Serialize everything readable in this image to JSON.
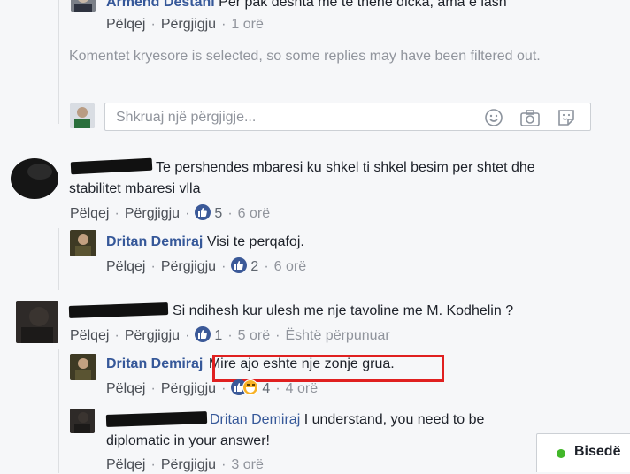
{
  "top_comment": {
    "author": "Armend Destani",
    "text": "Per pak deshta me te thene dicka, ama e lash",
    "actions": {
      "like": "Pëlqej",
      "reply": "Përgjigju",
      "time": "1 orë"
    }
  },
  "filter_notice": "Komentet kryesore is selected, so some replies may have been filtered out.",
  "reply_box": {
    "placeholder": "Shkruaj një përgjigje..."
  },
  "comments": [
    {
      "text": "Te pershendes mbaresi ku shkel ti shkel besim per shtet dhe stabilitet mbaresi vlla",
      "actions": {
        "like": "Pëlqej",
        "reply": "Përgjigju",
        "likes": "5",
        "time": "6 orë"
      },
      "reply": {
        "author": "Dritan Demiraj",
        "text": "Visi te perqafoj.",
        "actions": {
          "like": "Pëlqej",
          "reply": "Përgjigju",
          "likes": "2",
          "time": "6 orë"
        }
      }
    },
    {
      "text": "Si ndihesh kur ulesh me nje tavoline me M. Kodhelin ?",
      "actions": {
        "like": "Pëlqej",
        "reply": "Përgjigju",
        "likes": "1",
        "time": "5 orë",
        "edited": "Është përpunuar"
      },
      "replies": [
        {
          "author": "Dritan Demiraj",
          "text": "Mire ajo eshte nje zonje grua.",
          "actions": {
            "like": "Pëlqej",
            "reply": "Përgjigju",
            "likes": "4",
            "time": "4 orë"
          }
        },
        {
          "mention": "Dritan Demiraj",
          "text": " I understand, you need to be diplomatic in your answer!",
          "actions": {
            "like": "Pëlqej",
            "reply": "Përgjigju",
            "time": "3 orë"
          }
        }
      ]
    }
  ],
  "chat": {
    "label": "Bisedë",
    "status_color": "#42b72a"
  },
  "colors": {
    "link": "#365899",
    "meta": "#606770",
    "like_badge": "#3b5998",
    "highlight": "#e02020"
  }
}
